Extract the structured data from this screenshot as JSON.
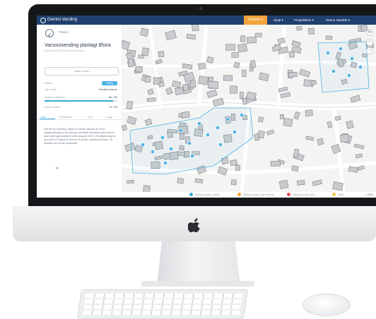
{
  "app": {
    "brand": "Gemini Varsling",
    "nav_active": "Gemini ▾",
    "nav_items": [
      "Hjelp ▾",
      "Prosjektliste ▾",
      "Hanne Sandvik ▾"
    ]
  },
  "panel": {
    "back_label": "Tilbake",
    "title": "Varsoutsending planlagt Østra",
    "subtitle": "Utført 12.10.2018 av Hanne Sandvik",
    "button": "Utfør varsel",
    "rows": [
      {
        "label": "Status",
        "value": "Ferdig"
      },
      {
        "label": "Type ikke",
        "value": "Private beboer"
      },
      {
        "label": "Antall mottakere",
        "value": "80 / 80"
      },
      {
        "label": "Antall svarte",
        "value": "75 / 80"
      }
    ],
    "progress": 0.94,
    "tabs": [
      "Info",
      "Mottakere",
      "Kart",
      "Logg"
    ],
    "description": "Det blir en melding i løpet av første halvdel av 2019. Oppgradering av utrustning i området. Arbeidet med planen skal være gjennomført innen august 2019. Vennligst sørg for at porten er lukket til enhver tid under arbeidsperioden. Ta kontakt om du har spørsmål."
  },
  "map": {
    "zoom_in": "+",
    "zoom_out": "−",
    "scale": "1:4000"
  },
  "legend": [
    {
      "color": "#35a9d9",
      "label": "Mottaker-varslet, mottatt"
    },
    {
      "color": "#f2a33b",
      "label": "Mottaker-varslet, ikke bekreftet"
    },
    {
      "color": "#e5484d",
      "label": "Mottaker-varslet, feilet"
    },
    {
      "color": "#f2c94c",
      "label": "Andre"
    }
  ],
  "colors": {
    "topbar": "#1f3f6e",
    "accent": "#35a9d9",
    "nav_active": "#f2a33b"
  }
}
